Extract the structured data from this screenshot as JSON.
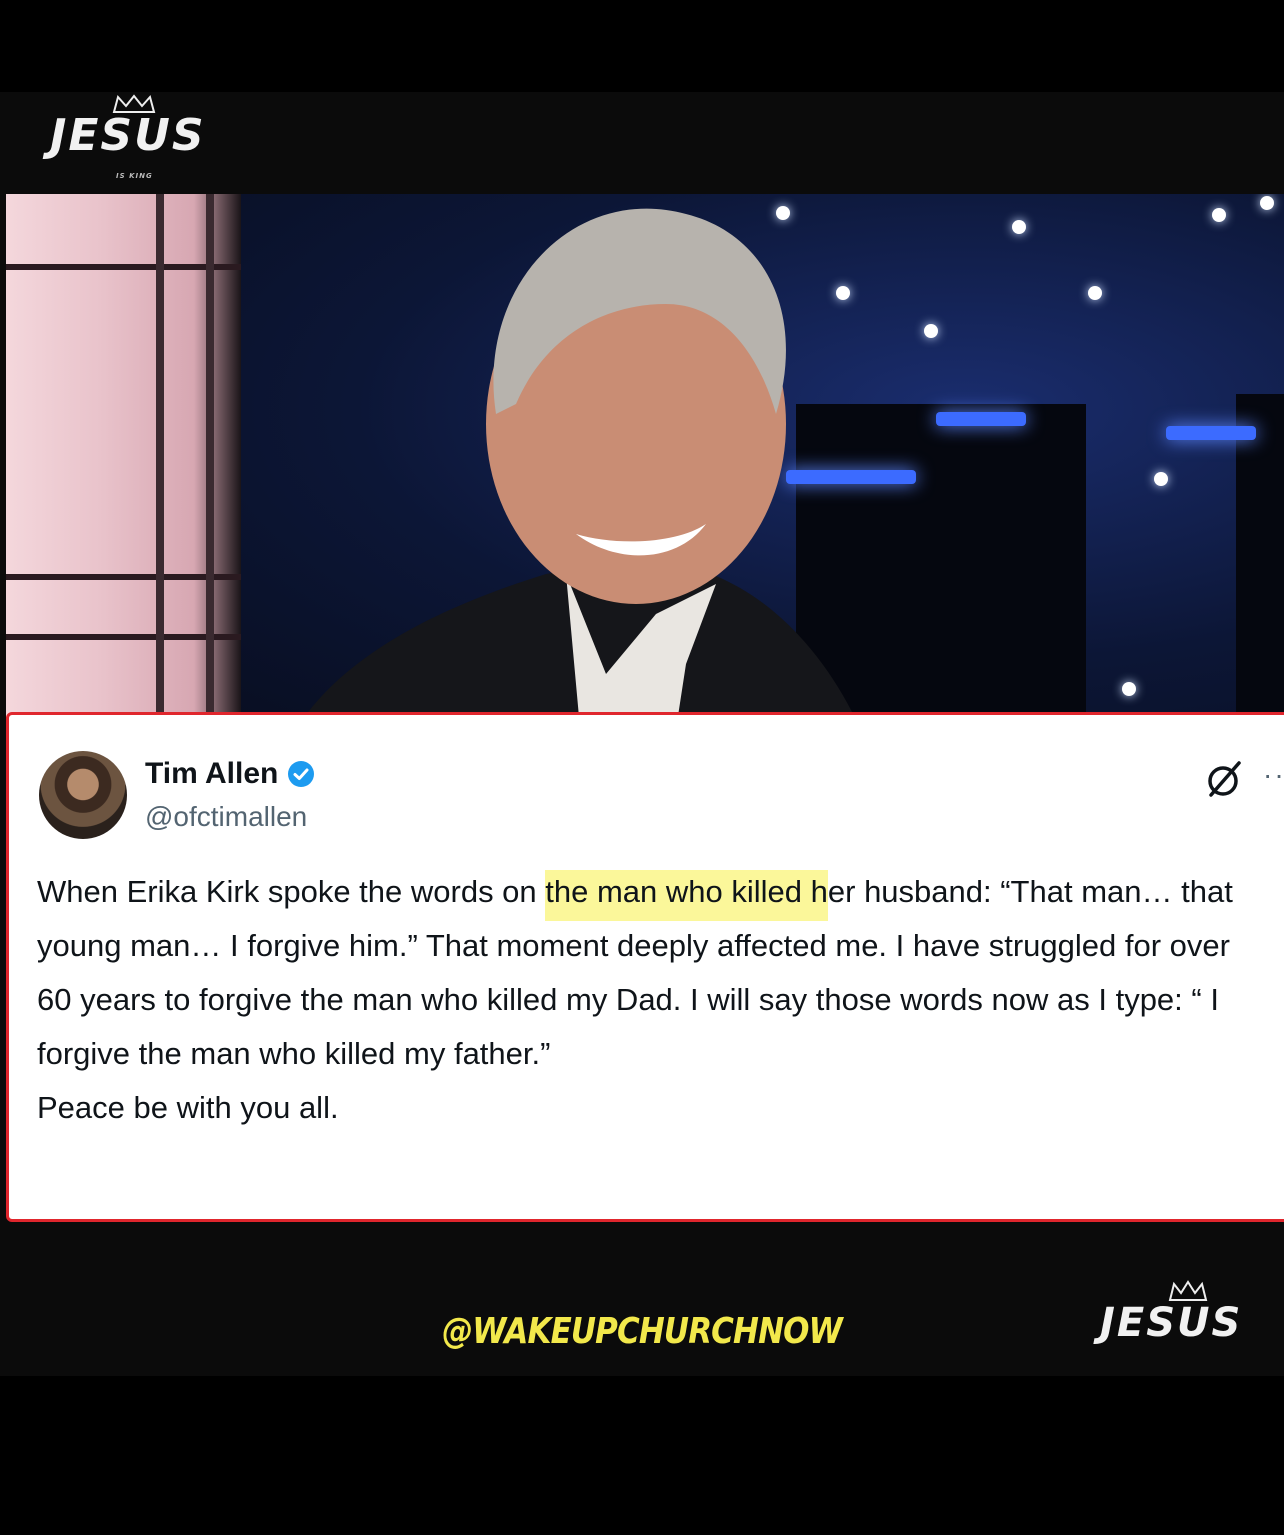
{
  "logo": {
    "word": "JESUS",
    "tagline": "IS KING",
    "crown_icon": "crown-icon"
  },
  "tweet": {
    "name": "Tim Allen",
    "verified_icon": "verified-badge-icon",
    "handle": "@ofctimallen",
    "grok_icon": "grok-icon",
    "more": "··",
    "body_before": "When Erika Kirk spoke the words on ",
    "body_highlight": "the man who killed h",
    "body_after": "er husband: “That man… that young man… I forgive him.”  That moment deeply affected me.  I have struggled for over 60 years to forgive the man who killed my Dad. I will say those words now as I type: “ I forgive the man who killed my father.”",
    "closing": "Peace be with you all."
  },
  "footer": {
    "handle": "@WAKEUPCHURCHNOW"
  },
  "colors": {
    "card_border": "#e0262d",
    "highlight": "#fbf79a",
    "handle_yellow": "#f2e84b",
    "verified_blue": "#1d9bf0"
  }
}
